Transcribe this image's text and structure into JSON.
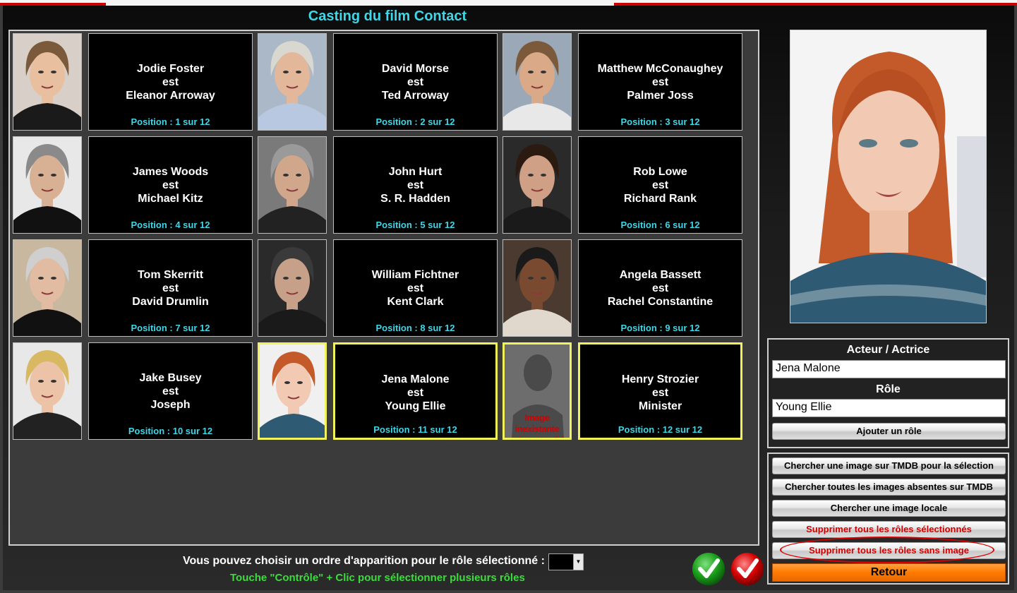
{
  "window": {
    "title": "Casting du film Contact"
  },
  "cast": [
    {
      "actor": "Jodie Foster",
      "verb": "est",
      "role": "Eleanor Arroway",
      "position": "Position : 1 sur 12",
      "photo": "photo-jodie-foster"
    },
    {
      "actor": "David Morse",
      "verb": "est",
      "role": "Ted Arroway",
      "position": "Position : 2 sur 12",
      "photo": "photo-david-morse"
    },
    {
      "actor": "Matthew McConaughey",
      "verb": "est",
      "role": "Palmer Joss",
      "position": "Position : 3 sur 12",
      "photo": "photo-matthew-mcconaughey"
    },
    {
      "actor": "James Woods",
      "verb": "est",
      "role": "Michael Kitz",
      "position": "Position : 4 sur 12",
      "photo": "photo-james-woods"
    },
    {
      "actor": "John Hurt",
      "verb": "est",
      "role": "S. R. Hadden",
      "position": "Position : 5 sur 12",
      "photo": "photo-john-hurt"
    },
    {
      "actor": "Rob Lowe",
      "verb": "est",
      "role": "Richard Rank",
      "position": "Position : 6 sur 12",
      "photo": "photo-rob-lowe"
    },
    {
      "actor": "Tom Skerritt",
      "verb": "est",
      "role": "David Drumlin",
      "position": "Position : 7 sur 12",
      "photo": "photo-tom-skerritt"
    },
    {
      "actor": "William Fichtner",
      "verb": "est",
      "role": "Kent Clark",
      "position": "Position : 8 sur 12",
      "photo": "photo-william-fichtner"
    },
    {
      "actor": "Angela Bassett",
      "verb": "est",
      "role": "Rachel Constantine",
      "position": "Position : 9 sur 12",
      "photo": "photo-angela-bassett"
    },
    {
      "actor": "Jake Busey",
      "verb": "est",
      "role": "Joseph",
      "position": "Position : 10 sur 12",
      "photo": "photo-jake-busey"
    },
    {
      "actor": "Jena Malone",
      "verb": "est",
      "role": "Young Ellie",
      "position": "Position : 11 sur 12",
      "photo": "photo-jena-malone",
      "selected": true
    },
    {
      "actor": "Henry Strozier",
      "verb": "est",
      "role": "Minister",
      "position": "Position : 12 sur 12",
      "photo": "missing",
      "selected": true
    }
  ],
  "missing_image": {
    "line1": "Image inexistante",
    "line2": "ou inaccessible"
  },
  "panel": {
    "actor_label": "Acteur / Actrice",
    "actor_value": "Jena Malone",
    "role_label": "Rôle",
    "role_value": "Young Ellie",
    "add_role_button": "Ajouter un rôle",
    "search_tmdb_selection": "Chercher une image sur TMDB pour la sélection",
    "search_tmdb_all": "Chercher toutes les images absentes sur TMDB",
    "search_local": "Chercher une image locale",
    "delete_selected": "Supprimer tous les rôles sélectionnés",
    "delete_no_image": "Supprimer tous les rôles sans image",
    "back_button": "Retour"
  },
  "footer": {
    "order_prompt": "Vous pouvez choisir un ordre d'apparition pour le rôle sélectionné :",
    "order_value": "",
    "multi_select_hint": "Touche \"Contrôle\" + Clic pour sélectionner plusieurs rôles"
  },
  "colors": {
    "title": "#3fd7e8",
    "position_text": "#3fd7e8",
    "selection_border": "#f2f25a",
    "danger_text": "#d40000",
    "hint_text": "#3ddc3d",
    "retour_button": "#ff7a00",
    "validate_button": "#1a9e1a",
    "cancel_button": "#d40000"
  },
  "icons": {
    "validate": "checkmark-icon",
    "cancel": "checkmark-icon"
  }
}
